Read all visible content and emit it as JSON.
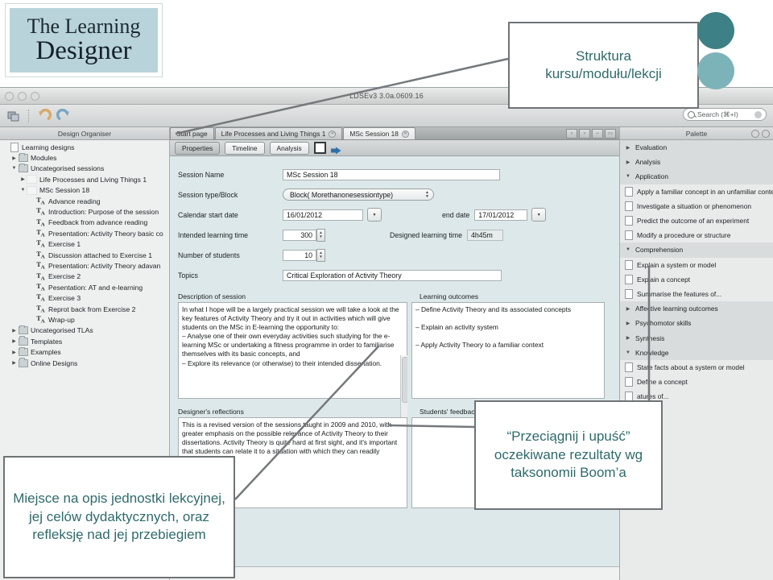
{
  "logo": {
    "line1": "The Learning",
    "line2": "Designer"
  },
  "window": {
    "title": "LDSEv3 3.0a.0609.16",
    "search_placeholder": "Search (⌘+I)",
    "toolbar_icons": [
      "new-design-icon",
      "undo-icon",
      "redo-icon"
    ]
  },
  "design_organiser": {
    "header": "Design Organiser",
    "items": [
      {
        "label": "Learning designs",
        "depth": 0,
        "twisty": "",
        "icon": "doc"
      },
      {
        "label": "Modules",
        "depth": 1,
        "twisty": "▶",
        "icon": "folder"
      },
      {
        "label": "Uncategorised sessions",
        "depth": 1,
        "twisty": "▼",
        "icon": "folder"
      },
      {
        "label": "Life Processes and Living Things 1",
        "depth": 2,
        "twisty": "▶",
        "icon": "blank"
      },
      {
        "label": "MSc Session 18",
        "depth": 2,
        "twisty": "▼",
        "icon": "blank"
      },
      {
        "label": "Advance reading",
        "depth": 3,
        "twisty": "",
        "icon": "ta"
      },
      {
        "label": "Introduction: Purpose of the session",
        "depth": 3,
        "twisty": "",
        "icon": "ta"
      },
      {
        "label": "Feedback from advance reading",
        "depth": 3,
        "twisty": "",
        "icon": "ta"
      },
      {
        "label": "Presentation: Activity Theory basic co",
        "depth": 3,
        "twisty": "",
        "icon": "ta"
      },
      {
        "label": "Exercise 1",
        "depth": 3,
        "twisty": "",
        "icon": "ta"
      },
      {
        "label": "Discussion attached to Exercise 1",
        "depth": 3,
        "twisty": "",
        "icon": "ta"
      },
      {
        "label": "Presentation: Activity Theory adavan",
        "depth": 3,
        "twisty": "",
        "icon": "ta"
      },
      {
        "label": "Exercise 2",
        "depth": 3,
        "twisty": "",
        "icon": "ta"
      },
      {
        "label": "Pesentation: AT and e-learning",
        "depth": 3,
        "twisty": "",
        "icon": "ta"
      },
      {
        "label": "Exercise 3",
        "depth": 3,
        "twisty": "",
        "icon": "ta"
      },
      {
        "label": "Reprot back from Exercise 2",
        "depth": 3,
        "twisty": "",
        "icon": "ta"
      },
      {
        "label": "Wrap-up",
        "depth": 3,
        "twisty": "",
        "icon": "ta"
      },
      {
        "label": "Uncategorised TLAs",
        "depth": 1,
        "twisty": "▶",
        "icon": "folder"
      },
      {
        "label": "Templates",
        "depth": 1,
        "twisty": "▶",
        "icon": "folder"
      },
      {
        "label": "Examples",
        "depth": 1,
        "twisty": "▶",
        "icon": "folder"
      },
      {
        "label": "Online Designs",
        "depth": 1,
        "twisty": "▶",
        "icon": "folder"
      }
    ]
  },
  "tabs": [
    {
      "label": "Start page",
      "closable": false,
      "active": false
    },
    {
      "label": "Life Processes and Living Things 1",
      "closable": true,
      "active": false
    },
    {
      "label": "MSc Session 18",
      "closable": true,
      "active": true
    }
  ],
  "subtabs": [
    {
      "label": "Properties",
      "active": true
    },
    {
      "label": "Timeline",
      "active": false
    },
    {
      "label": "Analysis",
      "active": false
    }
  ],
  "nav_buttons": [
    "‹",
    "›",
    "−",
    "▭"
  ],
  "form": {
    "session_name_label": "Session Name",
    "session_name_value": "MSc Session 18",
    "session_type_label": "Session type/Block",
    "session_type_value": "Block( Morethanonesessiontype)",
    "calendar_start_label": "Calendar start date",
    "calendar_start_value": "16/01/2012",
    "end_date_label": "end date",
    "end_date_value": "17/01/2012",
    "intended_time_label": "Intended learning time",
    "intended_time_value": "300",
    "designed_time_label": "Designed learning time",
    "designed_time_value": "4h45m",
    "students_label": "Number of students",
    "students_value": "10",
    "topics_label": "Topics",
    "topics_value": "Critical Exploration of Activity Theory",
    "description_label": "Description of session",
    "description_value": "In what I hope will be a largely practical session we will take a look at the key features of Activity Theory and try it out in activities which will give students on the MSc in E-learning the opportunity to:\n– Analyse one of their own everyday activities such studying for the e-learning MSc or undertaking a fitness programme in order to familiarise themselves with its basic concepts, and\n– Explore its relevance (or otherwise) to their intended dissertation.",
    "outcomes_label": "Learning outcomes",
    "outcomes_value": "– Define Activity Theory and its associated concepts\n\n– Explain an activity system\n\n– Apply Activity Theory to a familiar context",
    "reflections_label": "Designer's reflections",
    "reflections_value": "This is a revised version of the sessions taught in 2009 and 2010, with greater emphasis on the possible relevance of Activity Theory to their dissertations. Activity Theory is quite hard at first sight, and it's important that students can relate it to a situation with which they can readily identify.",
    "feedback_label": "Students' feedback"
  },
  "palette": {
    "header": "Palette",
    "items": [
      {
        "label": "Evaluation",
        "type": "group",
        "twisty": "▶"
      },
      {
        "label": "Analysis",
        "type": "group",
        "twisty": "▶"
      },
      {
        "label": "Application",
        "type": "group",
        "twisty": "▼"
      },
      {
        "label": "Apply a familiar concept in an unfamiliar conte",
        "type": "leaf",
        "twisty": ""
      },
      {
        "label": "Investigate a situation or phenomenon",
        "type": "leaf",
        "twisty": ""
      },
      {
        "label": "Predict the outcome of an experiment",
        "type": "leaf",
        "twisty": ""
      },
      {
        "label": "Modify a procedure or structure",
        "type": "leaf",
        "twisty": ""
      },
      {
        "label": "Comprehension",
        "type": "group",
        "twisty": "▼"
      },
      {
        "label": "Explain a system or model",
        "type": "leaf",
        "twisty": ""
      },
      {
        "label": "Explain a concept",
        "type": "leaf",
        "twisty": ""
      },
      {
        "label": "Summarise the features of...",
        "type": "leaf",
        "twisty": ""
      },
      {
        "label": "Affective learning outcomes",
        "type": "group",
        "twisty": "▶"
      },
      {
        "label": "Psychomotor skills",
        "type": "group",
        "twisty": "▶"
      },
      {
        "label": "Synthesis",
        "type": "group",
        "twisty": "▶"
      },
      {
        "label": "Knowledge",
        "type": "group",
        "twisty": "▼"
      },
      {
        "label": "State facts about a system or model",
        "type": "leaf",
        "twisty": ""
      },
      {
        "label": "Define a concept",
        "type": "leaf",
        "twisty": ""
      },
      {
        "label": "atures of...",
        "type": "leaf",
        "twisty": ""
      }
    ]
  },
  "callouts": {
    "structure": "Struktura kursu/modułu/lekcji",
    "description": "Miejsce na opis jednostki lekcyjnej, jej celów dydaktycznych, oraz refleksję nad jej przebiegiem",
    "dragdrop": "“Przeciągnij i upuść” oczekiwane rezultaty wg taksonomii Boom’a"
  },
  "colors": {
    "teal_dark": "#3d8086",
    "teal_light": "#7cb3b8",
    "callout_text": "#2e6a6c",
    "logo_bg": "#b9d3da"
  }
}
